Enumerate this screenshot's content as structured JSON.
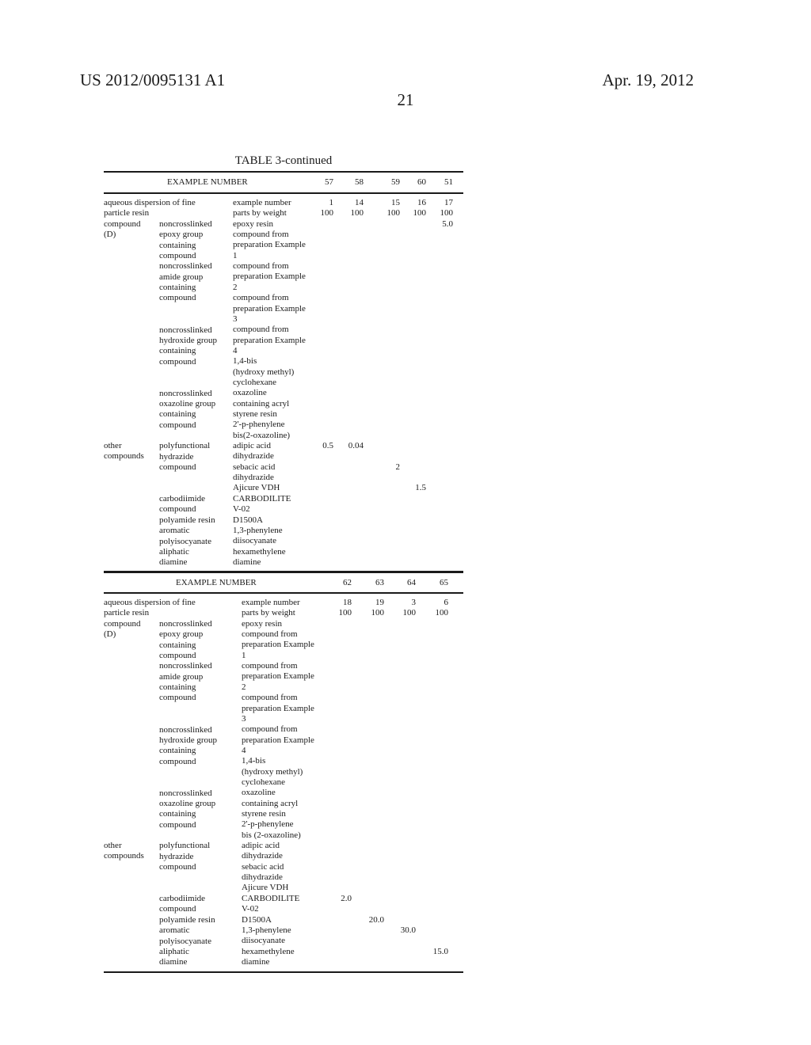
{
  "header": {
    "patent_number": "US 2012/0095131 A1",
    "date": "Apr. 19, 2012",
    "page_number": "21"
  },
  "table": {
    "title": "TABLE 3-continued",
    "sections": [
      {
        "example_header": "EXAMPLE NUMBER",
        "examples": [
          "57",
          "58",
          "59",
          "60",
          "51"
        ],
        "col1": [
          "aqueous dispersion of fine",
          "particle resin",
          "compound",
          "(D)",
          "",
          "",
          "",
          "",
          "",
          "",
          "",
          "",
          "",
          "",
          "",
          "",
          "",
          "",
          "",
          "",
          "",
          "",
          "",
          "",
          "other",
          "compounds"
        ],
        "col2": [
          "",
          "",
          "noncrosslinked",
          "epoxy group",
          "containing",
          "compound",
          "noncrosslinked",
          "amide group",
          "containing",
          "compound",
          "",
          "",
          "noncrosslinked",
          "hydroxide group",
          "containing",
          "compound",
          "",
          "",
          "noncrosslinked",
          "oxazoline group",
          "containing",
          "compound",
          "",
          "polyfunctional",
          "hydrazide",
          "compound",
          "",
          "",
          "carbodiimide",
          "compound",
          "polyamide resin",
          "aromatic",
          "polyisocyanate",
          "aliphatic",
          "diamine"
        ],
        "col3": [
          "example number",
          "parts by weight",
          "epoxy resin",
          "compound from",
          "preparation Example",
          "1",
          "compound from",
          "preparation Example",
          "2",
          "compound from",
          "preparation Example",
          "3",
          "compound from",
          "preparation Example",
          "4",
          "1,4-bis",
          "(hydroxy methyl)",
          "cyclohexane",
          "oxazoline",
          "containing acryl",
          "styrene resin",
          "2'-p-phenylene",
          "bis(2-oxazoline)",
          "adipic acid",
          "dihydrazide",
          "sebacic acid",
          "dihydrazide",
          "Ajicure VDH",
          "CARBODILITE",
          "V-02",
          "D1500A",
          "1,3-phenylene",
          "diisocyanate",
          "hexamethylene",
          "diamine"
        ],
        "values": [
          {
            "row": 0,
            "cells": [
              "1",
              "14",
              "15",
              "16",
              "17"
            ]
          },
          {
            "row": 1,
            "cells": [
              "100",
              "100",
              "100",
              "100",
              "100"
            ]
          },
          {
            "row": 2,
            "cells": [
              "",
              "",
              "",
              "",
              "5.0"
            ]
          },
          {
            "row": 23,
            "cells": [
              "0.5",
              "0.04",
              "",
              "",
              ""
            ]
          },
          {
            "row": 25,
            "cells": [
              "",
              "",
              "2",
              "",
              ""
            ]
          },
          {
            "row": 27,
            "cells": [
              "",
              "",
              "",
              "1.5",
              ""
            ]
          }
        ]
      },
      {
        "example_header": "EXAMPLE NUMBER",
        "examples": [
          "62",
          "63",
          "64",
          "65"
        ],
        "col1": [
          "aqueous dispersion of fine",
          "particle resin",
          "compound",
          "(D)",
          "",
          "",
          "",
          "",
          "",
          "",
          "",
          "",
          "",
          "",
          "",
          "",
          "",
          "",
          "",
          "",
          "",
          "",
          "",
          "other",
          "compounds"
        ],
        "col2": [
          "",
          "",
          "noncrosslinked",
          "epoxy group",
          "containing",
          "compound",
          "noncrosslinked",
          "amide group",
          "containing",
          "compound",
          "",
          "",
          "noncrosslinked",
          "hydroxide group",
          "containing",
          "compound",
          "",
          "",
          "noncrosslinked",
          "oxazoline group",
          "containing",
          "compound",
          "",
          "polyfunctional",
          "hydrazide",
          "compound",
          "",
          "",
          "carbodiimide",
          "compound",
          "polyamide resin",
          "aromatic",
          "polyisocyanate",
          "aliphatic",
          "diamine"
        ],
        "col3": [
          "example number",
          "parts by weight",
          "epoxy resin",
          "compound from",
          "preparation Example",
          "1",
          "compound from",
          "preparation Example",
          "2",
          "compound from",
          "preparation Example",
          "3",
          "compound from",
          "preparation Example",
          "4",
          "1,4-bis",
          "(hydroxy methyl)",
          "cyclohexane",
          "oxazoline",
          "containing acryl",
          "styrene resin",
          "2'-p-phenylene",
          "bis (2-oxazoline)",
          "adipic acid",
          "dihydrazide",
          "sebacic acid",
          "dihydrazide",
          "Ajicure VDH",
          "CARBODILITE",
          "V-02",
          "D1500A",
          "1,3-phenylene",
          "diisocyanate",
          "hexamethylene",
          "diamine"
        ],
        "values": [
          {
            "row": 0,
            "cells": [
              "18",
              "19",
              "3",
              "6"
            ]
          },
          {
            "row": 1,
            "cells": [
              "100",
              "100",
              "100",
              "100"
            ]
          },
          {
            "row": 28,
            "cells": [
              "2.0",
              "",
              "",
              ""
            ]
          },
          {
            "row": 30,
            "cells": [
              "",
              "20.0",
              "",
              ""
            ]
          },
          {
            "row": 31,
            "cells": [
              "",
              "",
              "30.0",
              ""
            ]
          },
          {
            "row": 33,
            "cells": [
              "",
              "",
              "",
              "15.0"
            ]
          }
        ]
      }
    ]
  }
}
